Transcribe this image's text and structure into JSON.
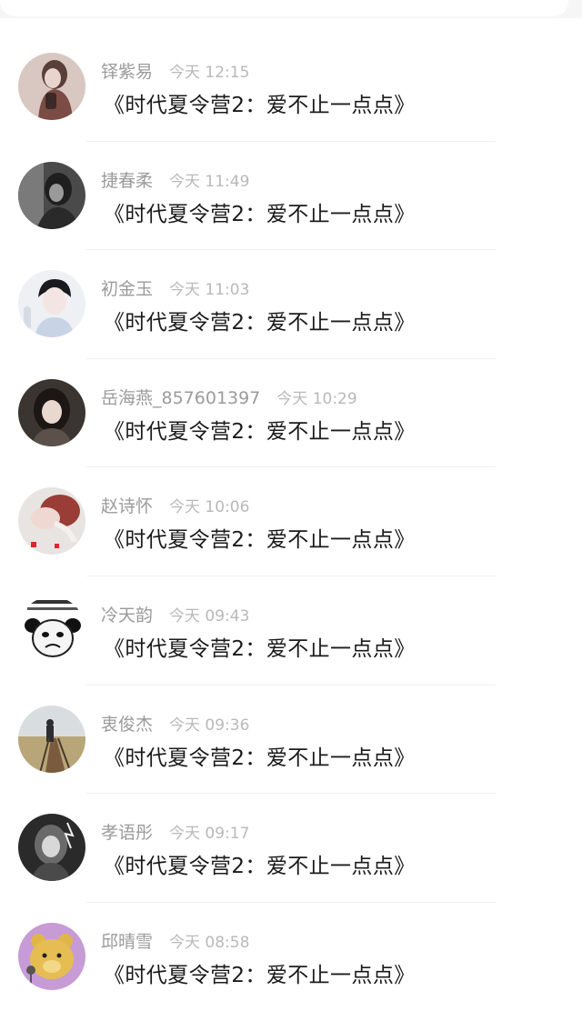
{
  "items": [
    {
      "name": "铎紫易",
      "time": "今天 12:15",
      "message": "《时代夏令营2：爱不止一点点》",
      "avatar": "avatar-woman-icon"
    },
    {
      "name": "捷春柔",
      "time": "今天 11:49",
      "message": "《时代夏令营2：爱不止一点点》",
      "avatar": "avatar-girl-dark-icon"
    },
    {
      "name": "初金玉",
      "time": "今天 11:03",
      "message": "《时代夏令营2：爱不止一点点》",
      "avatar": "avatar-boy-icon"
    },
    {
      "name": "岳海燕_857601397",
      "time": "今天 10:29",
      "message": "《时代夏令营2：爱不止一点点》",
      "avatar": "avatar-girl-icon"
    },
    {
      "name": "赵诗怀",
      "time": "今天 10:06",
      "message": "《时代夏令营2：爱不止一点点》",
      "avatar": "avatar-hands-icon"
    },
    {
      "name": "冷天韵",
      "time": "今天 09:43",
      "message": "《时代夏令营2：爱不止一点点》",
      "avatar": "avatar-panda-meme-icon"
    },
    {
      "name": "衷俊杰",
      "time": "今天 09:36",
      "message": "《时代夏令营2：爱不止一点点》",
      "avatar": "avatar-bridge-icon"
    },
    {
      "name": "孝语彤",
      "time": "今天 09:17",
      "message": "《时代夏令营2：爱不止一点点》",
      "avatar": "avatar-monochrome-icon"
    },
    {
      "name": "邱晴雪",
      "time": "今天 08:58",
      "message": "《时代夏令营2：爱不止一点点》",
      "avatar": "avatar-bear-icon"
    }
  ]
}
